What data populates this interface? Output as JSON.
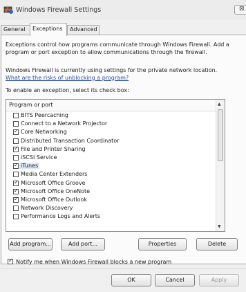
{
  "window": {
    "title": "Windows Firewall Settings",
    "close_glyph": "⊠"
  },
  "tabs": [
    {
      "label": "General",
      "active": false
    },
    {
      "label": "Exceptions",
      "active": true
    },
    {
      "label": "Advanced",
      "active": false
    }
  ],
  "intro": {
    "line1": "Exceptions control how programs communicate through Windows Firewall. Add a",
    "line2": "program or port exception to allow communications through the firewall."
  },
  "location": {
    "line1": "Windows Firewall is currently using settings for the private network location.",
    "risk_link": "What are the risks of unblocking a program?"
  },
  "instruction": "To enable an exception, select its check box:",
  "list": {
    "header": "Program or port",
    "items": [
      {
        "label": "BITS Peercaching",
        "checked": false
      },
      {
        "label": "Connect to a Network Projector",
        "checked": false
      },
      {
        "label": "Core Networking",
        "checked": true
      },
      {
        "label": "Distributed Transaction Coordinator",
        "checked": false
      },
      {
        "label": "File and Printer Sharing",
        "checked": true
      },
      {
        "label": "iSCSI Service",
        "checked": false
      },
      {
        "label": "iTunes",
        "checked": true
      },
      {
        "label": "Media Center Extenders",
        "checked": false
      },
      {
        "label": "Microsoft Office Groove",
        "checked": true
      },
      {
        "label": "Microsoft Office OneNote",
        "checked": true
      },
      {
        "label": "Microsoft Office Outlook",
        "checked": true
      },
      {
        "label": "Network Discovery",
        "checked": false
      },
      {
        "label": "Performance Logs and Alerts",
        "checked": false
      }
    ],
    "selected_index": 6
  },
  "buttons": {
    "add_program": "Add program...",
    "add_port": "Add port...",
    "properties": "Properties",
    "delete": "Delete"
  },
  "notify": {
    "label": "Notify me when Windows Firewall blocks a new program",
    "checked": true
  },
  "footer": {
    "ok": "OK",
    "cancel": "Cancel",
    "apply": "Apply"
  },
  "icons": {
    "window_icon": "firewall-shield-icon",
    "scroll_up": "▲",
    "scroll_down": "▼",
    "check": "✓"
  }
}
